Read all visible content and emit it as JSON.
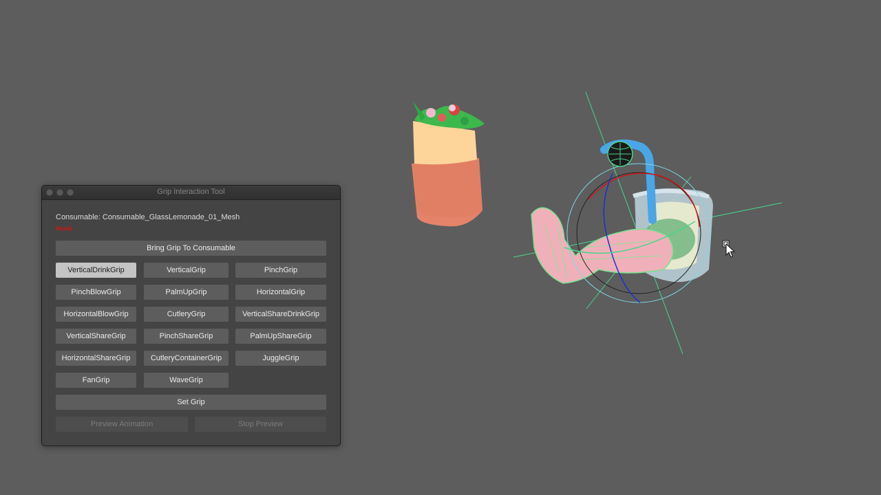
{
  "window": {
    "title": "Grip Interaction Tool",
    "consumable_label": "Consumable: Consumable_GlassLemonade_01_Mesh",
    "status_text": "Ready"
  },
  "buttons": {
    "bring_grip": "Bring Grip To Consumable",
    "set_grip": "Set Grip",
    "preview_animation": "Preview Animation",
    "stop_preview": "Stop Preview"
  },
  "grips": [
    "VerticalDrinkGrip",
    "VerticalGrip",
    "PinchGrip",
    "PinchBlowGrip",
    "PalmUpGrip",
    "HorizontalGrip",
    "HorizontalBlowGrip",
    "CutleryGrip",
    "VerticalShareDrinkGrip",
    "VerticalShareGrip",
    "PinchShareGrip",
    "PalmUpShareGrip",
    "HorizontalShareGrip",
    "CutleryContainerGrip",
    "JuggleGrip",
    "FanGrip",
    "WaveGrip"
  ],
  "selected_grip": "VerticalDrinkGrip",
  "colors": {
    "viewport_bg": "#5d5d5d",
    "window_bg": "#444444",
    "button_bg": "#5d5d5d",
    "selected_button_bg": "#c4c4c4",
    "status_color": "#e01010",
    "manipulator_green": "#4cd48c",
    "manipulator_blue": "#1e2fd0",
    "manipulator_red": "#d01818",
    "straw_blue": "#4aa6e6"
  }
}
